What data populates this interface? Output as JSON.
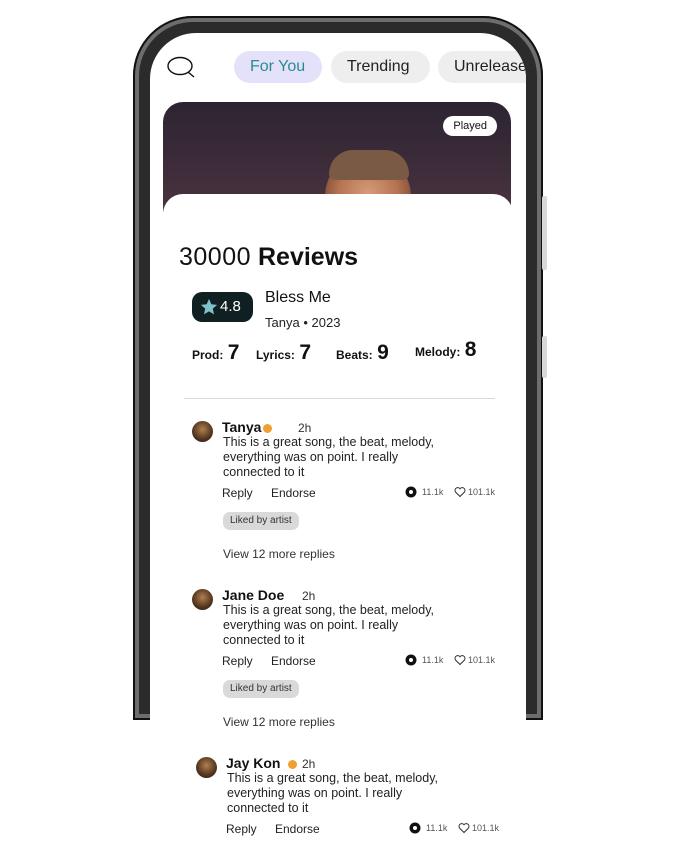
{
  "tabs": [
    "For You",
    "Trending",
    "Unreleased"
  ],
  "hero": {
    "badge": "Played"
  },
  "reviews": {
    "count": "30000",
    "label": "Reviews"
  },
  "song": {
    "rating": "4.8",
    "title": "Bless Me",
    "artist": "Tanya",
    "separator": "•",
    "year": "2023"
  },
  "scores": [
    {
      "label": "Prod:",
      "value": "7"
    },
    {
      "label": "Lyrics:",
      "value": "7"
    },
    {
      "label": "Beats:",
      "value": "9"
    },
    {
      "label": "Melody:",
      "value": "8"
    }
  ],
  "comments": [
    {
      "author": "Tanya",
      "verified": true,
      "time": "2h",
      "text": "This is a great song, the beat, melody, everything was on point. I really connected to it",
      "reply": "Reply",
      "endorse": "Endorse",
      "reactions": "11.1k",
      "likes": "101.1k",
      "chip": "Liked by artist",
      "more": "View 12 more replies"
    },
    {
      "author": "Jane Doe",
      "verified": false,
      "time": "2h",
      "text": "This is a great song, the beat, melody, everything was on point. I really connected to it",
      "reply": "Reply",
      "endorse": "Endorse",
      "reactions": "11.1k",
      "likes": "101.1k",
      "chip": "Liked by artist",
      "more": "View 12 more replies"
    },
    {
      "author": "Jay Kon",
      "verified": true,
      "time": "2h",
      "text": "This is a great song, the beat, melody, everything was on point. I really connected to it",
      "reply": "Reply",
      "endorse": "Endorse",
      "reactions": "11.1k",
      "likes": "101.1k"
    }
  ],
  "colors": {
    "tab_active_bg": "#e4e2fb",
    "tab_active_text": "#2a8b8d",
    "rating_bg": "#0f1f22",
    "star": "#7fc2c9",
    "verified": "#f0a030",
    "chip_bg": "#d9d9d9"
  },
  "icons": [
    "search-icon",
    "star-icon",
    "verified-icon",
    "reaction-icon",
    "heart-icon",
    "avatar"
  ]
}
